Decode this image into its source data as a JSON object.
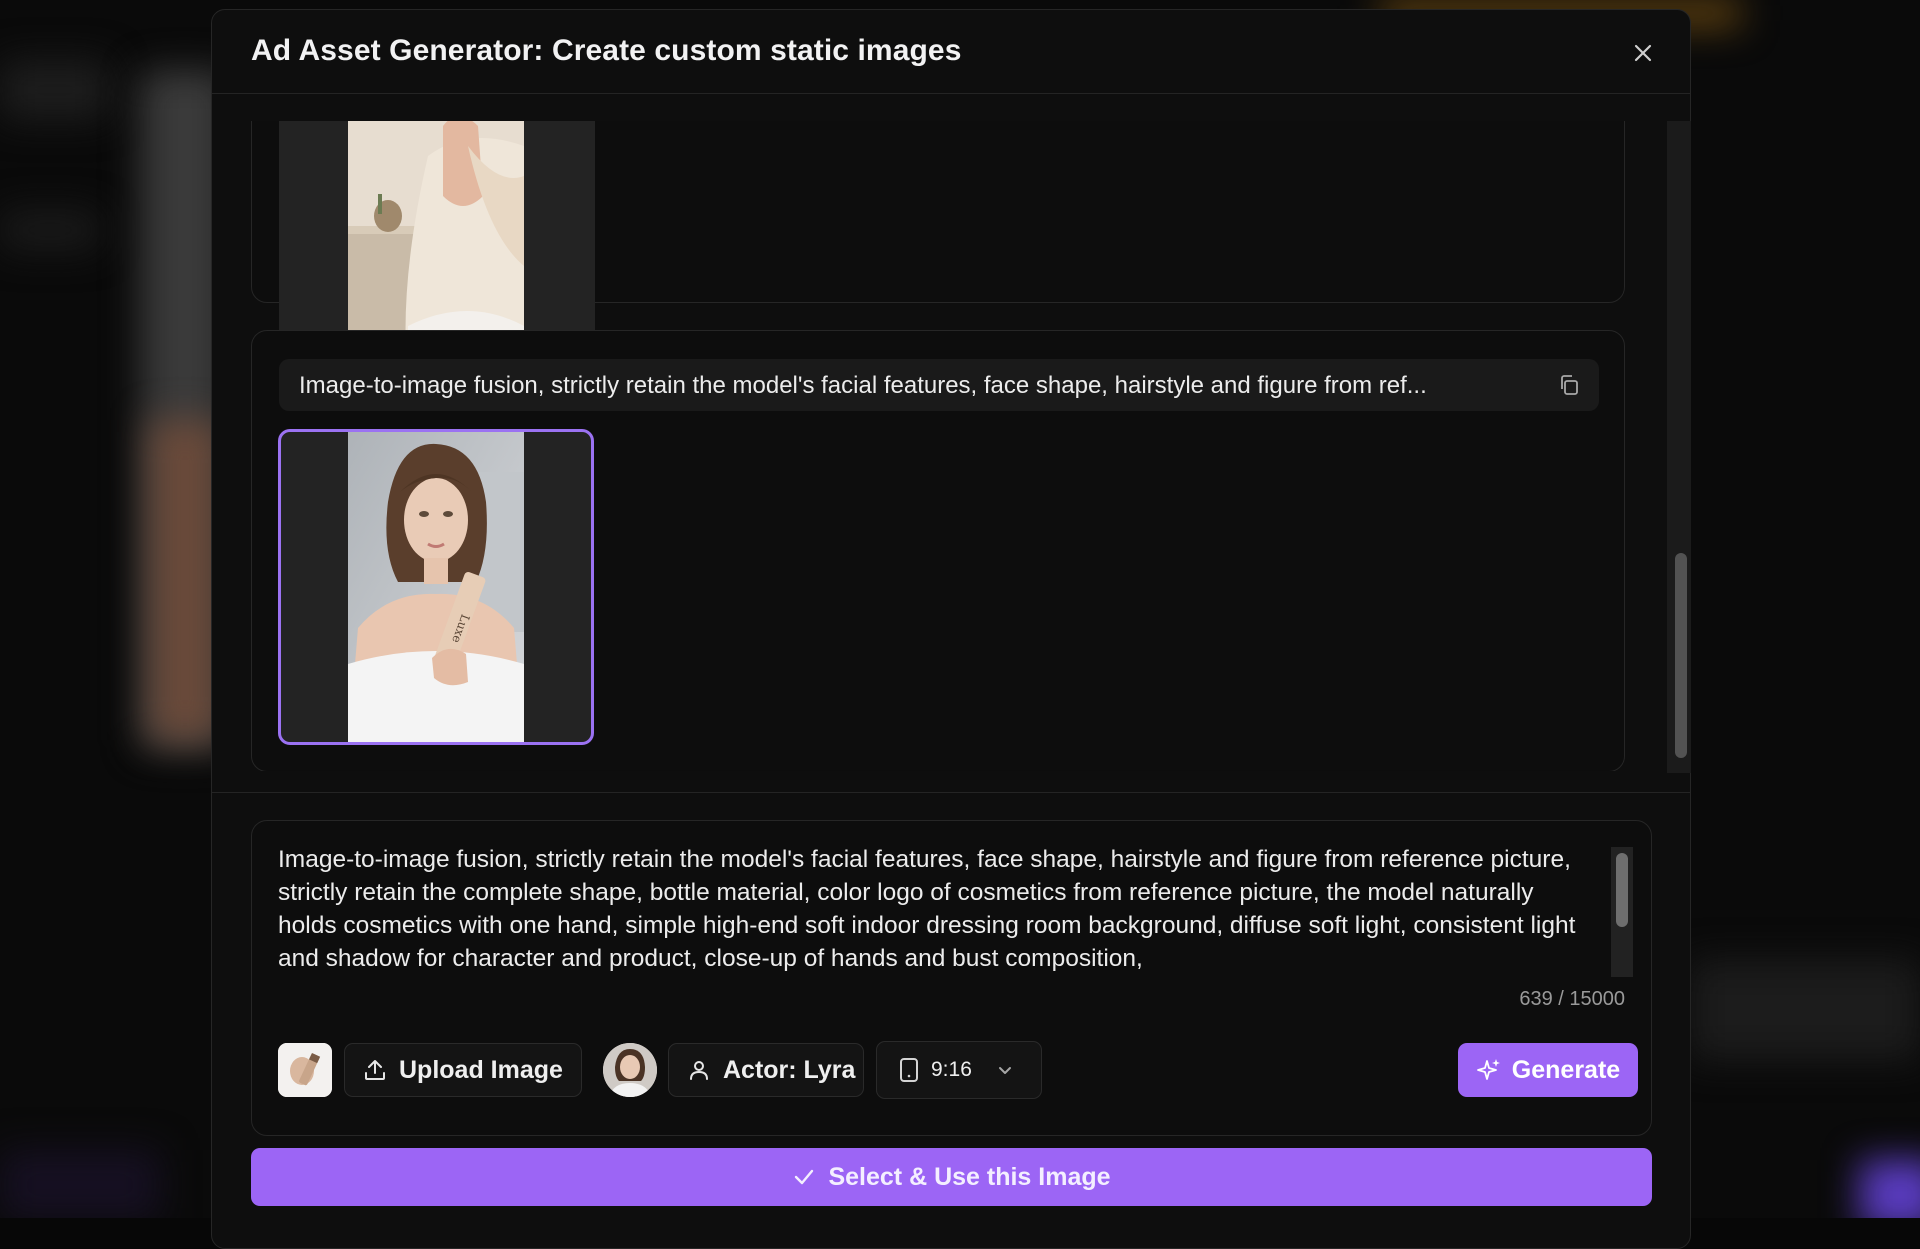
{
  "modal": {
    "title": "Ad Asset Generator: Create custom static images"
  },
  "history": {
    "items": [
      {
        "prompt": "",
        "image": "woman-holding-product-by-window"
      },
      {
        "prompt": "Image-to-image fusion, strictly retain the model's facial features, face shape, hairstyle and figure from ref...",
        "image": "woman-holding-luxe-tube",
        "selected": true
      }
    ]
  },
  "composer": {
    "prompt_text": "Image-to-image fusion, strictly retain the model's facial features, face shape, hairstyle and figure from reference picture, strictly retain the complete shape, bottle material, color logo of cosmetics from reference picture, the model naturally holds cosmetics with one hand, simple high-end soft indoor dressing room background, diffuse soft light, consistent light and shadow for character and product, close-up of hands and bust composition,",
    "char_count": "639 / 15000",
    "upload_label": "Upload Image",
    "actor_label": "Actor: Lyra",
    "aspect_ratio": "9:16",
    "generate_label": "Generate"
  },
  "footer": {
    "select_label": "Select & Use this Image"
  },
  "colors": {
    "accent": "#9c65f5",
    "selected_border": "#9b72f2",
    "modal_bg": "#0e0e0e"
  },
  "icons": [
    "close-icon",
    "copy-icon",
    "upload-icon",
    "user-icon",
    "phone-icon",
    "chevron-down-icon",
    "sparkle-icon",
    "check-icon"
  ]
}
